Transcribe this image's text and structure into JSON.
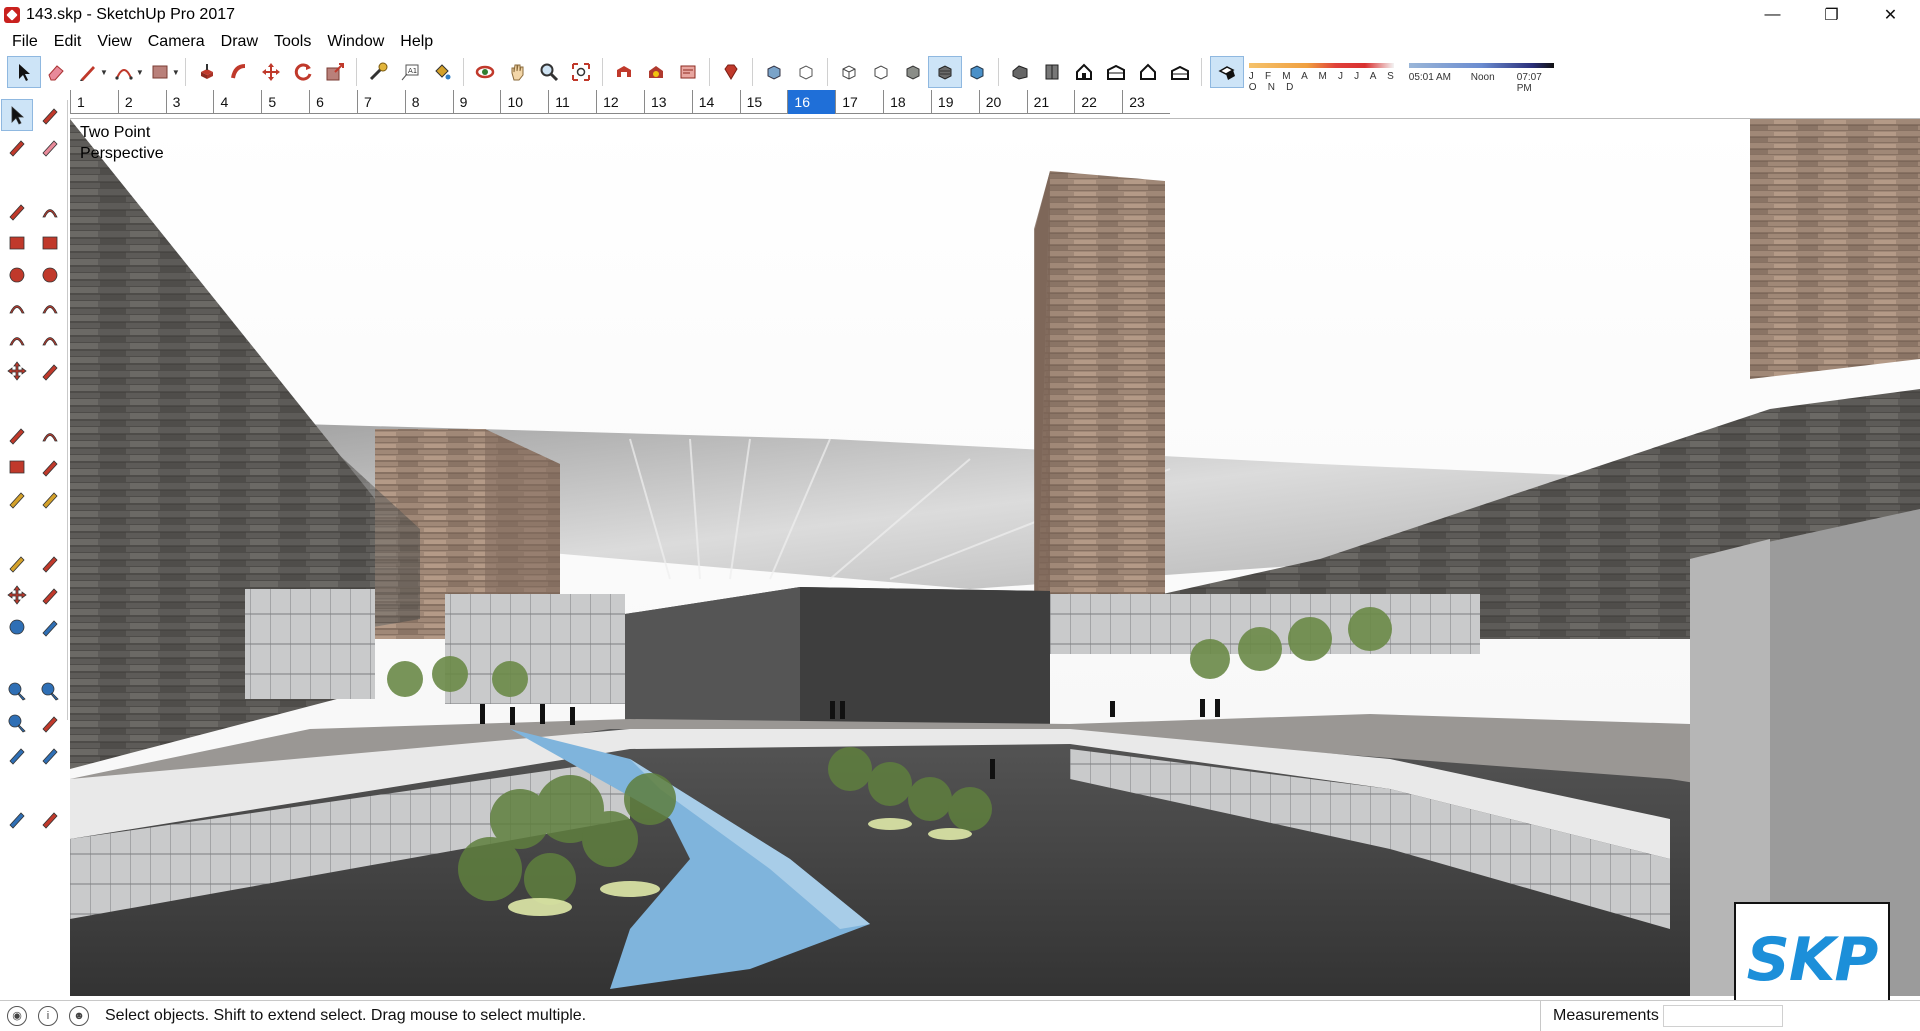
{
  "window": {
    "title": "143.skp - SketchUp Pro 2017",
    "controls": [
      "minimize",
      "maximize",
      "close"
    ]
  },
  "menu": [
    "File",
    "Edit",
    "View",
    "Camera",
    "Draw",
    "Tools",
    "Window",
    "Help"
  ],
  "toolbar": {
    "groups": [
      [
        "select-tool",
        "eraser-tool",
        "pencil-tool",
        "arc-tool",
        "rectangle-tool"
      ],
      [
        "push-pull-tool",
        "follow-me-tool",
        "move-tool",
        "rotate-tool",
        "scale-tool"
      ],
      [
        "tape-measure-tool",
        "text-tool",
        "paint-bucket-tool"
      ],
      [
        "orbit-tool",
        "pan-tool",
        "zoom-tool",
        "zoom-extents-tool"
      ],
      [
        "3d-warehouse",
        "extension-warehouse",
        "layout-send"
      ],
      [
        "ruby-console"
      ],
      [
        "xray-style",
        "back-edges-style"
      ],
      [
        "wireframe-style",
        "hidden-line-style",
        "shaded-style",
        "textured-style",
        "monochrome-style"
      ],
      [
        "iso-view",
        "top-view",
        "front-view",
        "right-view",
        "back-view",
        "left-view"
      ],
      [
        "shadows-toggle"
      ]
    ],
    "shadow_months": "J F M A M J J A S O N D",
    "shadow_time_start": "05:01 AM",
    "shadow_time_mid": "Noon",
    "shadow_time_end": "07:07 PM"
  },
  "scene_tabs": [
    "1",
    "2",
    "3",
    "4",
    "5",
    "6",
    "7",
    "8",
    "9",
    "10",
    "11",
    "12",
    "13",
    "14",
    "15",
    "16",
    "17",
    "18",
    "19",
    "20",
    "21",
    "22",
    "23"
  ],
  "selected_scene": "16",
  "left_palette": [
    "select-tool",
    "component-tool",
    "paint-bucket-tool",
    "eraser-tool",
    "line-tool",
    "freehand-tool",
    "rectangle-tool",
    "rotated-rectangle-tool",
    "circle-tool",
    "polygon-tool",
    "arc-tool",
    "two-point-arc-tool",
    "three-point-arc-tool",
    "pie-tool",
    "move-tool",
    "push-pull-tool",
    "rotate-tool",
    "follow-me-tool",
    "scale-tool",
    "offset-tool",
    "tape-measure-tool",
    "dimension-tool",
    "protractor-tool",
    "text-tool",
    "axes-tool",
    "3d-text-tool",
    "orbit-tool",
    "pan-tool",
    "zoom-tool",
    "zoom-window-tool",
    "zoom-extents-tool",
    "previous-view-tool",
    "position-camera-tool",
    "look-around-tool",
    "walk-tool",
    "section-plane-tool"
  ],
  "viewport": {
    "camera_label_line1": "Two Point",
    "camera_label_line2": "Perspective"
  },
  "logo": {
    "text": "SKP"
  },
  "status": {
    "message": "Select objects. Shift to extend select. Drag mouse to select multiple.",
    "measurements_label": "Measurements",
    "measurements_value": ""
  },
  "colors": {
    "selection_blue": "#1f6fd8",
    "stone_dark": "#5a5855",
    "stone_tan": "#a08877",
    "water": "#7fb4dc",
    "tree_green": "#5f7f3e"
  }
}
